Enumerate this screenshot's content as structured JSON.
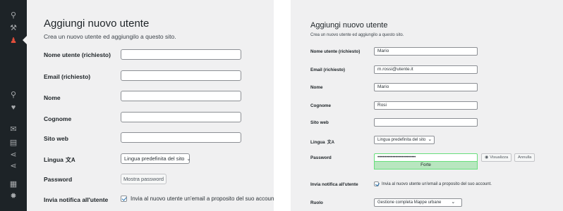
{
  "left": {
    "sidebar_icons": [
      "customize-icon",
      "tools-icon",
      "users-icon",
      "pin-icon",
      "heart-icon",
      "mail-icon",
      "briefcase-icon",
      "share-icon",
      "share-alt-icon",
      "sheet-icon",
      "gear-icon"
    ],
    "title": "Aggiungi nuovo utente",
    "subtitle": "Crea un nuovo utente ed aggiungilo a questo sito.",
    "labels": {
      "username": "Nome utente (richiesto)",
      "email": "Email (richiesto)",
      "first_name": "Nome",
      "last_name": "Cognome",
      "website": "Sito web",
      "language": "Lingua",
      "password": "Password",
      "notify": "Invia notifica all'utente"
    },
    "values": {
      "username": "",
      "email": "",
      "first_name": "",
      "last_name": "",
      "website": ""
    },
    "language_select": "Lingua predefinita del sito",
    "show_password_button": "Mostra password",
    "notify_text": "Invia al nuovo utente un'email a proposito del suo account."
  },
  "right": {
    "title": "Aggiungi nuovo utente",
    "subtitle": "Crea un nuovo utente ed aggiungilo a questo sito.",
    "labels": {
      "username": "Nome utente (richiesto)",
      "email": "Email (richiesto)",
      "first_name": "Nome",
      "last_name": "Cognome",
      "website": "Sito web",
      "language": "Lingua",
      "password": "Password",
      "notify": "Invia notifica all'utente",
      "role": "Ruolo"
    },
    "values": {
      "username": "Mario",
      "email": "m.rossi@utente.it",
      "first_name": "Mario",
      "last_name": "Rosi",
      "website": ""
    },
    "language_select": "Lingua predefinita del sito",
    "password_masked": "••••••••••••••••••••••••••••••",
    "strength": "Forte",
    "show_button": "Visualizza",
    "cancel_button": "Annulla",
    "notify_text": "Invia al nuovo utente un'email a proposito del suo account.",
    "role_select": "Gestione completa Mappe urbane"
  },
  "colors": {
    "sidebar_bg": "#1d2327",
    "active_icon": "#e04e3b",
    "strength_bg": "#b8e6bf",
    "strength_border": "#68de7c",
    "checkbox_check": "#2271b1"
  }
}
